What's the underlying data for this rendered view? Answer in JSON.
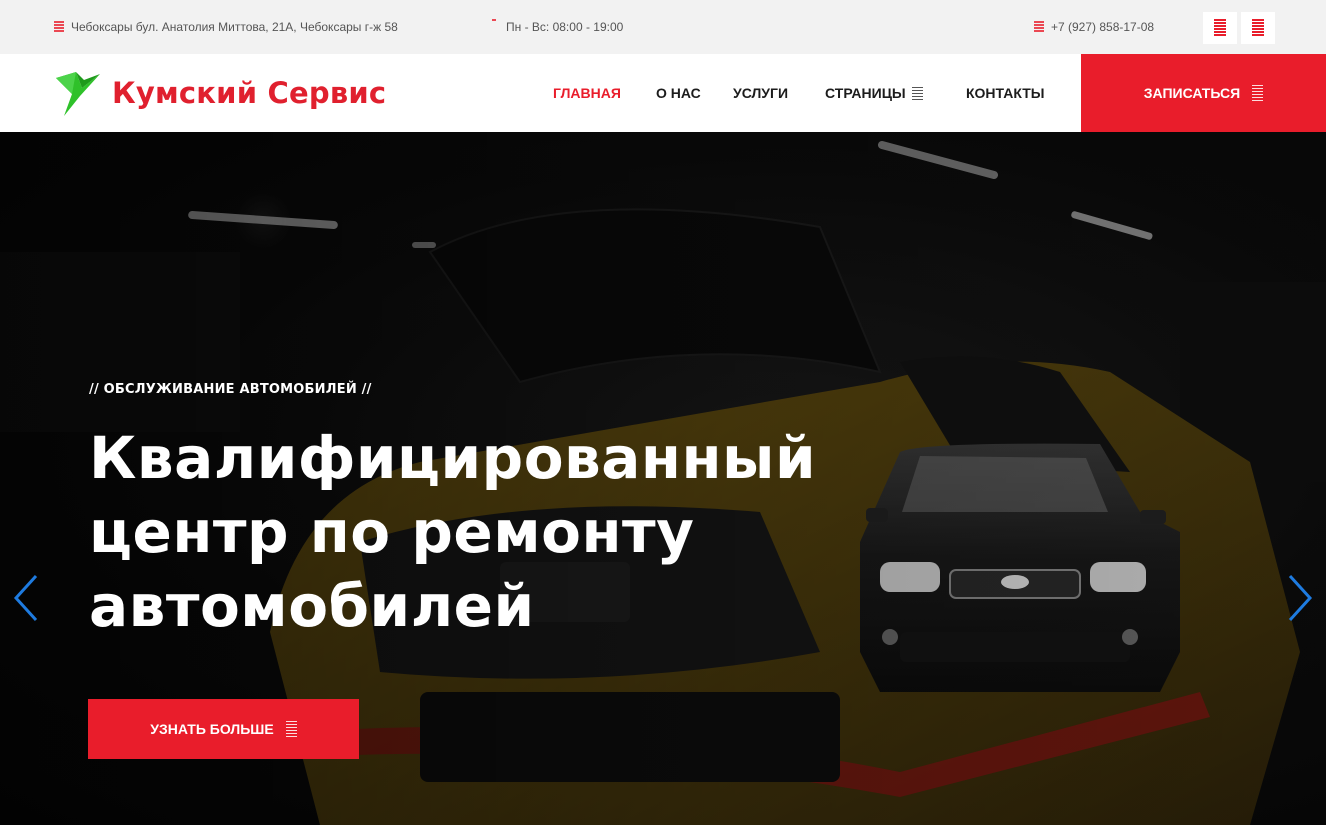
{
  "topbar": {
    "address": "Чебоксары бул. Анатолия Миттова, 21А, Чебоксары г-ж 58",
    "hours": "Пн - Вс: 08:00 - 19:00",
    "phone": "+7 (927) 858-17-08"
  },
  "header": {
    "logo_text": "Кумский Сервис",
    "nav": [
      {
        "label": "ГЛАВНАЯ"
      },
      {
        "label": "О НАС"
      },
      {
        "label": "УСЛУГИ"
      },
      {
        "label": "СТРАНИЦЫ"
      },
      {
        "label": "КОНТАКТЫ"
      }
    ],
    "cta_label": "ЗАПИСАТЬСЯ"
  },
  "hero": {
    "eyebrow": "// ОБСЛУЖИВАНИЕ АВТОМОБИЛЕЙ //",
    "title_lines": [
      "Квалифицированный",
      "центр по ремонту",
      "автомобилей"
    ],
    "button_label": "УЗНАТЬ БОЛЬШЕ"
  },
  "colors": {
    "accent": "#e91d2b",
    "logo_green": "#2fc12a",
    "slider_arrow": "#1e7be0"
  },
  "icons": {
    "address": "map-marker-icon",
    "hours": "clock-icon",
    "phone": "phone-icon",
    "social": [
      "social-icon",
      "social-icon"
    ],
    "dropdown": "dropdown-icon",
    "cta": "arrow-right-icon",
    "prev": "chevron-left-icon",
    "next": "chevron-right-icon"
  }
}
